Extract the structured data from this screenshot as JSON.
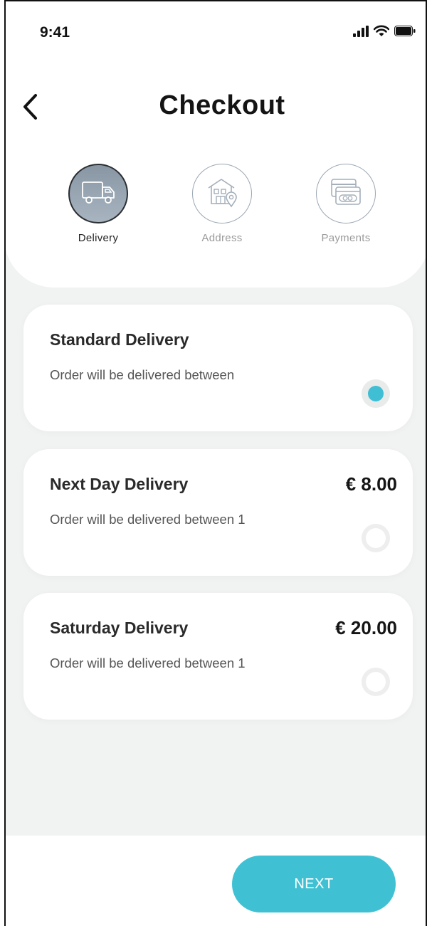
{
  "status_bar": {
    "time": "9:41",
    "icons": [
      "signal-icon",
      "wifi-icon",
      "battery-icon"
    ]
  },
  "header": {
    "title": "Checkout",
    "back_icon": "chevron-left-icon"
  },
  "stepper": {
    "steps": [
      {
        "label": "Delivery",
        "icon": "truck-icon",
        "state": "active"
      },
      {
        "label": "Address",
        "icon": "house-location-icon",
        "state": "inactive"
      },
      {
        "label": "Payments",
        "icon": "credit-card-icon",
        "state": "inactive"
      }
    ]
  },
  "delivery_options": [
    {
      "title": "Standard Delivery",
      "description": "Order will be delivered between",
      "price": "",
      "selected": true
    },
    {
      "title": "Next Day Delivery",
      "description": "Order will be delivered between 1",
      "price": "€ 8.00",
      "selected": false
    },
    {
      "title": "Saturday Delivery",
      "description": "Order will be delivered between 1",
      "price": "€ 20.00",
      "selected": false
    }
  ],
  "footer": {
    "next_label": "NEXT"
  },
  "colors": {
    "accent": "#40c1d3",
    "background": "#f1f2f2",
    "active_step": "#8896a4"
  }
}
